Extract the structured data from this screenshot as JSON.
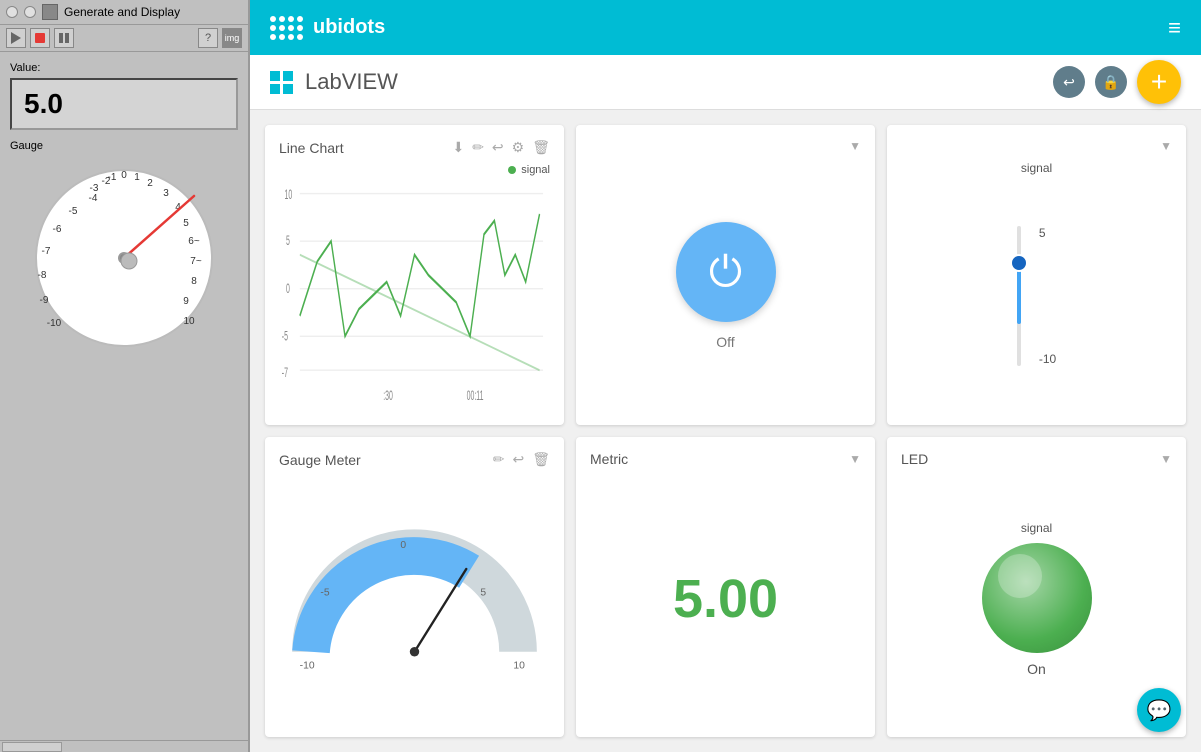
{
  "labview": {
    "title": "Generate and Display",
    "value_label": "Value:",
    "value": "5.0",
    "gauge_label": "Gauge",
    "toolbar_buttons": [
      "run",
      "stop",
      "pause",
      "help",
      "image"
    ]
  },
  "ubidots": {
    "logo_text": "ubidots",
    "app_title": "LabVIEW",
    "fab_label": "+",
    "widgets": {
      "line_chart": {
        "title": "Line Chart",
        "legend": "signal",
        "x_labels": [
          ":30",
          "00:11"
        ],
        "y_labels": [
          "10",
          "5",
          "0",
          "-5",
          "-7"
        ]
      },
      "power": {
        "title": "",
        "status": "Off"
      },
      "slider": {
        "title": "",
        "signal_label": "signal",
        "value_top": "5",
        "value_bottom": "-10"
      },
      "gauge_meter": {
        "title": "Gauge Meter",
        "min": "-10",
        "max": "10",
        "mid_left": "-5",
        "mid_right": "5",
        "center": "0"
      },
      "metric": {
        "title": "Metric",
        "value": "5.00"
      },
      "led": {
        "title": "LED",
        "signal_label": "signal",
        "status": "On"
      }
    }
  }
}
